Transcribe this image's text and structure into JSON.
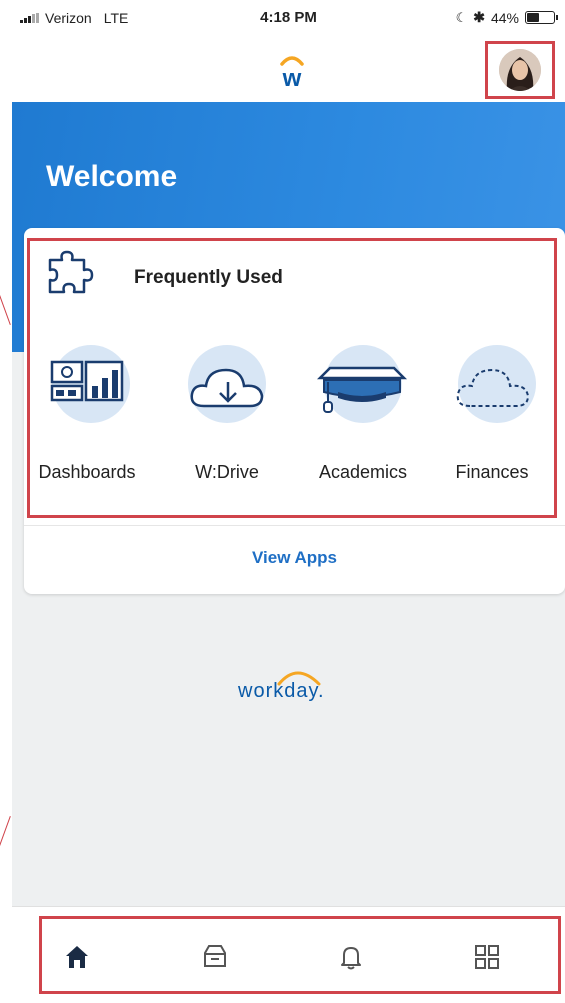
{
  "status_bar": {
    "carrier": "Verizon",
    "network": "LTE",
    "time": "4:18 PM",
    "battery": "44%",
    "battery_level": 0.44
  },
  "header": {
    "logo_letter": "w",
    "avatar_icon": "user-avatar"
  },
  "banner": {
    "welcome": "Welcome"
  },
  "frequently_used": {
    "title": "Frequently Used",
    "icon": "puzzle-icon",
    "apps": [
      {
        "label": "Dashboards",
        "icon": "dashboard-icon"
      },
      {
        "label": "W:Drive",
        "icon": "cloud-download-icon"
      },
      {
        "label": "Academics",
        "icon": "academic-cap-icon"
      },
      {
        "label": "Finances",
        "icon": "cloud-outline-icon"
      }
    ],
    "view_apps": "View Apps"
  },
  "footer_logo": "workday.",
  "bottom_nav": [
    {
      "name": "home",
      "icon": "home-icon"
    },
    {
      "name": "inbox",
      "icon": "inbox-icon"
    },
    {
      "name": "notifications",
      "icon": "bell-icon"
    },
    {
      "name": "apps",
      "icon": "apps-grid-icon"
    }
  ],
  "colors": {
    "brand_blue": "#1f7ad1",
    "link_blue": "#1f6fc5",
    "highlight_red": "#d0444b",
    "icon_bubble": "#d8e6f5",
    "logo_orange": "#f5a623"
  }
}
